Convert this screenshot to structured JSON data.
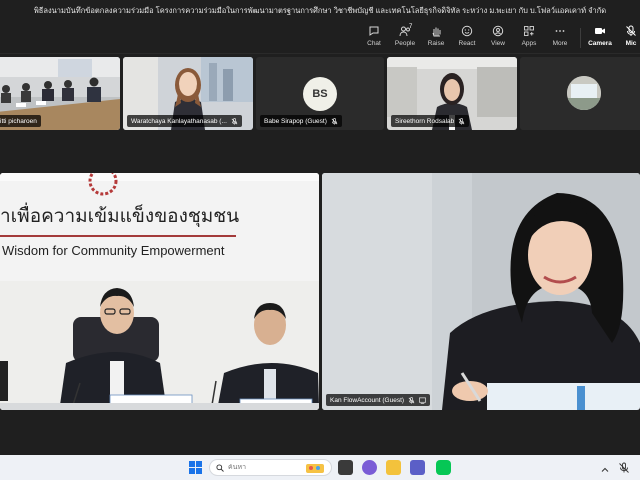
{
  "window": {
    "title": "พิธีลงนามบันทึกข้อตกลงความร่วมมือ โครงการความร่วมมือในการพัฒนามาตรฐานการศึกษา วิชาชีพบัญชี และเทคโนโลยีธุรกิจดิจิทัล ระหว่าง ม.พะเยา กับ บ.โฟลว์แอคเคาท์ จำกัด"
  },
  "toolbar": {
    "chat_label": "Chat",
    "people_label": "People",
    "people_count": "7",
    "raise_label": "Raise",
    "react_label": "React",
    "view_label": "View",
    "apps_label": "Apps",
    "more_label": "More",
    "camera_label": "Camera",
    "mic_label": "Mic"
  },
  "participants": {
    "tile1_name": "itti picharoen",
    "tile2_name": "Waratchaya Kanlayathanasab (...",
    "tile3_name": "Babe Sirapop (Guest)",
    "tile3_initials": "BS",
    "tile4_name": "Sireethorn Rodsalab",
    "main_right_name": "Kan FlowAccount (Guest)"
  },
  "stage": {
    "banner_thai": "าเพื่อความเข้มแข็งของชุมชน",
    "banner_en": "Wisdom for Community Empowerment"
  },
  "taskbar": {
    "search_placeholder": "ค้นหา"
  },
  "colors": {
    "app_bg": "#1f1f1f",
    "tile_bg": "#2b2b2b",
    "accent": "#6264a7"
  }
}
